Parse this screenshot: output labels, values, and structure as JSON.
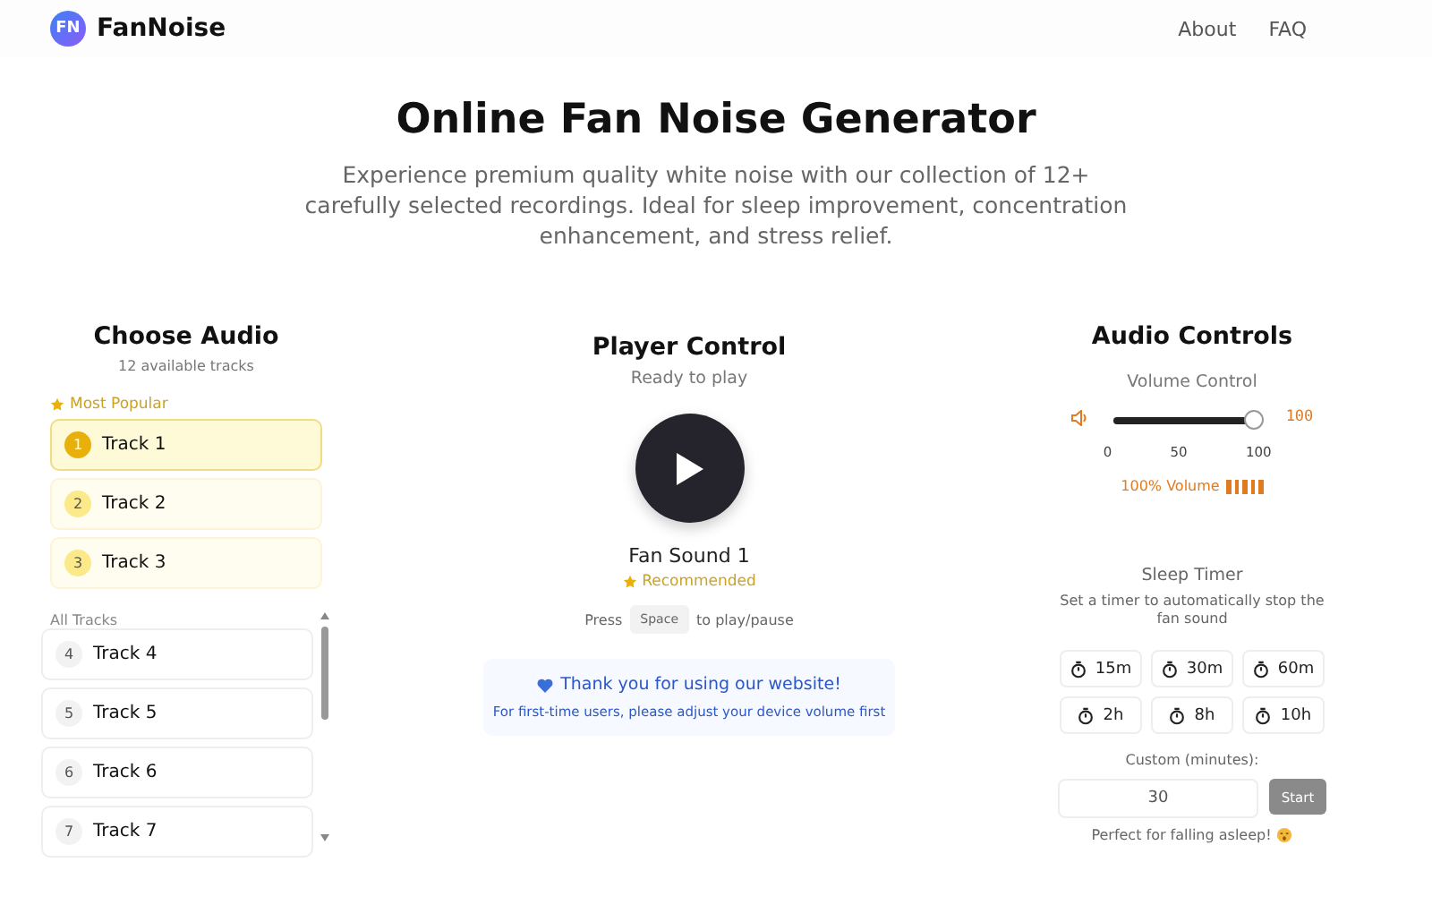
{
  "brand": {
    "logo": "FN",
    "name": "FanNoise"
  },
  "nav": [
    "About",
    "FAQ"
  ],
  "hero": {
    "title": "Online Fan Noise Generator",
    "subtitle": "Experience premium quality white noise with our collection of 12+ carefully selected recordings. Ideal for sleep improvement, concentration enhancement, and stress relief."
  },
  "choose_audio": {
    "title": "Choose Audio",
    "count": "12 available tracks",
    "popular_label": "Most Popular",
    "popular": [
      {
        "rank": "1",
        "label": "Track 1",
        "selected": true
      },
      {
        "rank": "2",
        "label": "Track 2",
        "selected": false
      },
      {
        "rank": "3",
        "label": "Track 3",
        "selected": false
      }
    ],
    "all_label": "All Tracks",
    "tracks": [
      {
        "rank": "4",
        "label": "Track 4",
        "selected": false
      },
      {
        "rank": "5",
        "label": "Track 5",
        "selected": false
      },
      {
        "rank": "6",
        "label": "Track 6",
        "selected": false
      },
      {
        "rank": "7",
        "label": "Track 7",
        "selected": false
      }
    ]
  },
  "player": {
    "title": "Player Control",
    "status": "Ready to play",
    "playing": false,
    "track": "Fan Sound 1",
    "badge": "Recommended",
    "hint_before": "Press",
    "key": "Space",
    "hint_after": "to play/pause",
    "thanks": "Thank you for using our website!",
    "note": "For first-time users, please adjust your device volume first"
  },
  "audio_controls": {
    "title": "Audio Controls",
    "volume_label": "Volume Control",
    "level": 1.0,
    "ticks": [
      "0",
      "50",
      "100"
    ],
    "reading": "100",
    "volume_text": "100% Volume",
    "timer_title": "Sleep Timer",
    "timer_desc": "Set a timer to automatically stop the fan sound",
    "timers": [
      {
        "label": "15m",
        "selected": false
      },
      {
        "label": "30m",
        "selected": false
      },
      {
        "label": "60m",
        "selected": false
      },
      {
        "label": "2h",
        "selected": false
      },
      {
        "label": "8h",
        "selected": false
      },
      {
        "label": "10h",
        "selected": false
      }
    ],
    "custom_label": "Custom (minutes):",
    "custom_value": "30",
    "start": "Start",
    "footer": "Perfect for falling asleep!"
  }
}
